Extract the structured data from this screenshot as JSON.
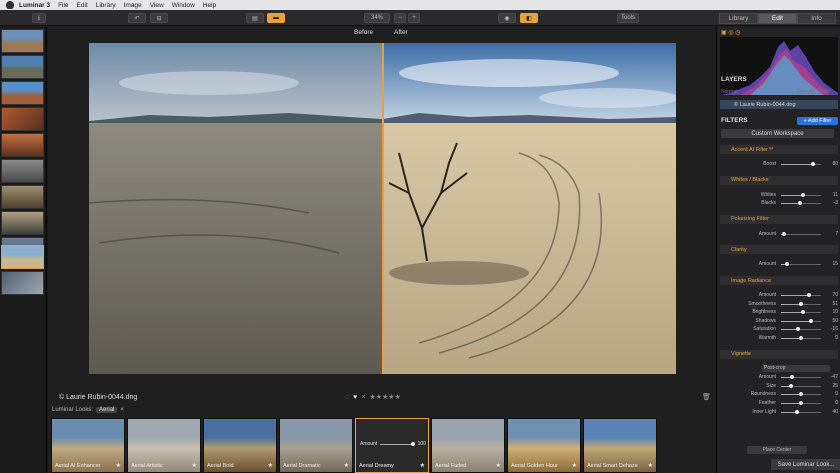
{
  "menubar": {
    "app": "Luminar 3",
    "items": [
      "File",
      "Edit",
      "Library",
      "Image",
      "View",
      "Window",
      "Help"
    ]
  },
  "toolbar": {
    "zoom": "34%",
    "minus": "−",
    "plus": "+",
    "tools": "Tools"
  },
  "tabs": [
    "Library",
    "Edit",
    "Info"
  ],
  "compare": {
    "before": "Before",
    "after": "After"
  },
  "image_name": "© Laurie Rubin-0044.dng",
  "looks_bar": {
    "label": "Luminar Looks:",
    "filter": "Aerial"
  },
  "looks": [
    {
      "name": "Aerial AI Enhancer"
    },
    {
      "name": "Aerial Artistic"
    },
    {
      "name": "Aerial Bold"
    },
    {
      "name": "Aerial Dramatic"
    },
    {
      "name": "Aerial Dreamy",
      "selected": true,
      "amount_label": "Amount",
      "amount": "100"
    },
    {
      "name": "Aerial Faded"
    },
    {
      "name": "Aerial Golden Hour"
    },
    {
      "name": "Aerial Smart Dehaze"
    }
  ],
  "panel": {
    "layers_title": "LAYERS",
    "layer_mode": "Normal",
    "layer_opacity": "Opacity: 100%",
    "layer_name": "© Laurie Rubin-0044.dng",
    "filters_title": "FILTERS",
    "add_filter": "+ Add Filter",
    "workspace": "Custom Workspace",
    "save": "Save Luminar Look...",
    "place_center": "Place Center"
  },
  "filters": [
    {
      "title": "Accent AI Filter™",
      "rows": [
        {
          "name": "Boost",
          "value": "80",
          "level": 0.8
        }
      ]
    },
    {
      "title": "Whites / Blacks",
      "rows": [
        {
          "name": "Whites",
          "value": "11",
          "level": 0.555
        },
        {
          "name": "Blacks",
          "value": "-3",
          "level": 0.485
        }
      ]
    },
    {
      "title": "Polarizing Filter",
      "rows": [
        {
          "name": "Amount",
          "value": "7",
          "level": 0.07
        }
      ]
    },
    {
      "title": "Clarity",
      "rows": [
        {
          "name": "Amount",
          "value": "15",
          "level": 0.15
        }
      ]
    },
    {
      "title": "Image Radiance",
      "rows": [
        {
          "name": "Amount",
          "value": "70",
          "level": 0.7
        },
        {
          "name": "Smoothness",
          "value": "51",
          "level": 0.51
        },
        {
          "name": "Brightness",
          "value": "10",
          "level": 0.55
        },
        {
          "name": "Shadows",
          "value": "50",
          "level": 0.75
        },
        {
          "name": "Saturation",
          "value": "-16",
          "level": 0.42
        },
        {
          "name": "Warmth",
          "value": "0",
          "level": 0.5
        }
      ]
    },
    {
      "title": "Vignette",
      "rows": [
        {
          "name": "Mode",
          "value": "Post-crop",
          "dropdown": true
        },
        {
          "name": "Amount",
          "value": "-47",
          "level": 0.265
        },
        {
          "name": "Size",
          "value": "25",
          "level": 0.25
        },
        {
          "name": "Roundness",
          "value": "0",
          "level": 0.5
        },
        {
          "name": "Feather",
          "value": "0",
          "level": 0.5
        },
        {
          "name": "Inner Light",
          "value": "40",
          "level": 0.4
        }
      ]
    }
  ],
  "colors": {
    "accent": "#e8a23c",
    "blue": "#2a74d9"
  }
}
